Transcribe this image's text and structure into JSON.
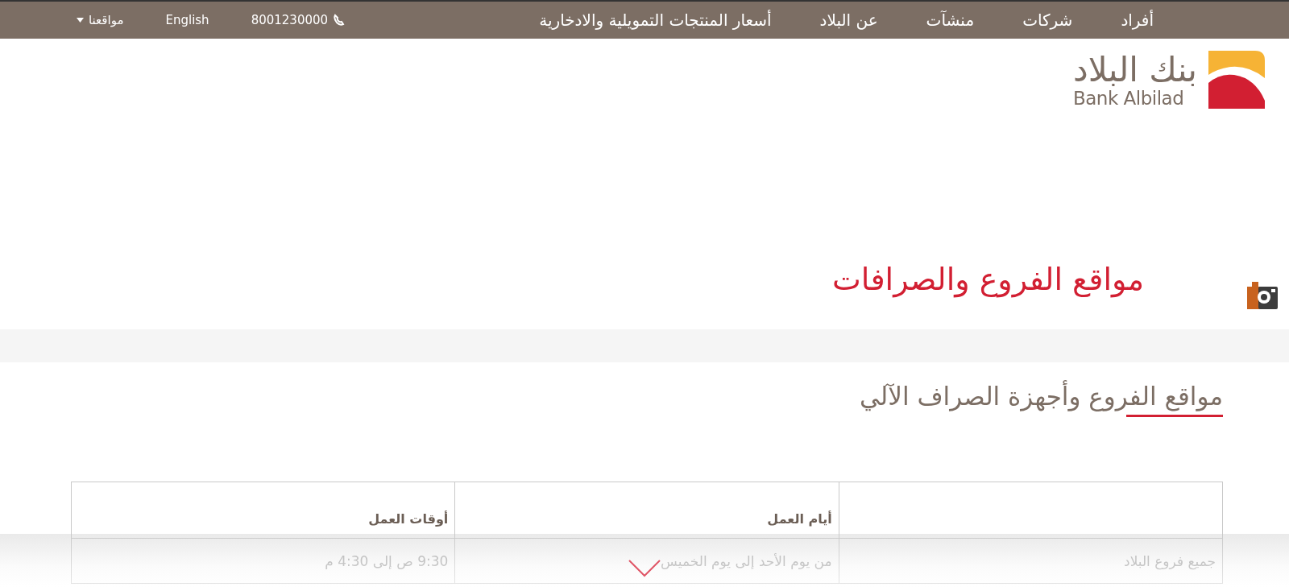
{
  "top_bar": {
    "nav": [
      {
        "label": "أفراد"
      },
      {
        "label": "شركات"
      },
      {
        "label": "منشآت"
      },
      {
        "label": "عن البلاد"
      },
      {
        "label": "أسعار المنتجات التمويلية والادخارية"
      }
    ],
    "phone": "8001230000",
    "language": "English",
    "locations_menu": "مواقعنا"
  },
  "logo": {
    "arabic": "بنك البلاد",
    "english": "Bank Albilad"
  },
  "page_title": "مواقع الفروع والصرافات",
  "section_title": "مواقع الفروع وأجهزة الصراف الآلي",
  "table": {
    "columns": [
      "",
      "أيام العمل",
      "أوقات العمل"
    ],
    "rows": [
      {
        "cells": [
          "جميع فروع البلاد",
          "من يوم الأحد إلى يوم الخميس",
          "9:30 ص  إلى 4:30 م"
        ]
      }
    ]
  }
}
